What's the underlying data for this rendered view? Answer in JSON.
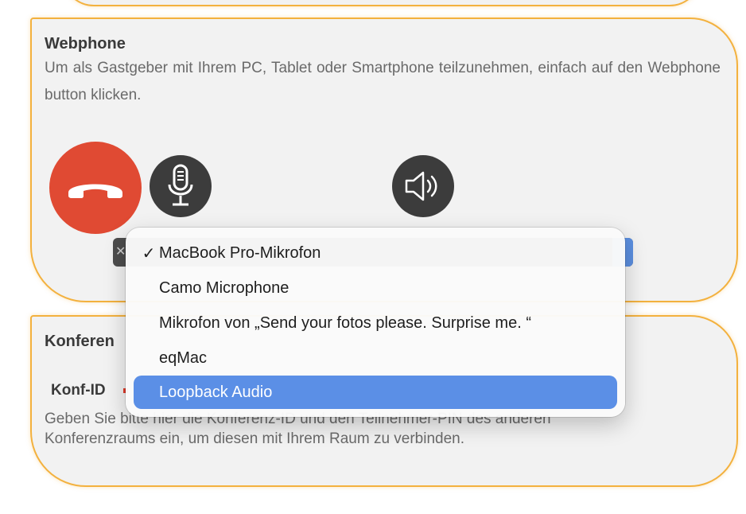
{
  "webphone": {
    "title": "Webphone",
    "description": "Um als Gastgeber mit Ihrem PC, Tablet oder Smartphone teilzunehmen, einfach auf den Webphone button klicken."
  },
  "konferenz": {
    "title_visible": "Konferen",
    "field_label": "Konf-ID",
    "description": "Geben Sie bitte hier die Konferenz-ID und den Teilnehmer-PIN des anderen Konferenzraums ein, um diesen mit Ihrem Raum zu verbinden."
  },
  "select": {
    "clear_glyph": "✕"
  },
  "mic_menu": {
    "items": [
      {
        "label": "MacBook Pro-Mikrofon",
        "checked": true,
        "highlighted": false
      },
      {
        "label": "Camo Microphone",
        "checked": false,
        "highlighted": false
      },
      {
        "label": "Mikrofon von „Send your fotos please. Surprise me. “",
        "checked": false,
        "highlighted": false
      },
      {
        "label": "eqMac",
        "checked": false,
        "highlighted": false
      },
      {
        "label": "Loopback Audio",
        "checked": false,
        "highlighted": true
      }
    ],
    "check_glyph": "✓"
  },
  "colors": {
    "panel_border": "#f3b13e",
    "hangup": "#e04a33",
    "icon_button": "#3c3c3c",
    "menu_highlight": "#5b8fe6"
  },
  "icons": [
    "hangup-phone-icon",
    "microphone-icon",
    "speaker-icon",
    "checkmark-icon",
    "clear-icon"
  ]
}
